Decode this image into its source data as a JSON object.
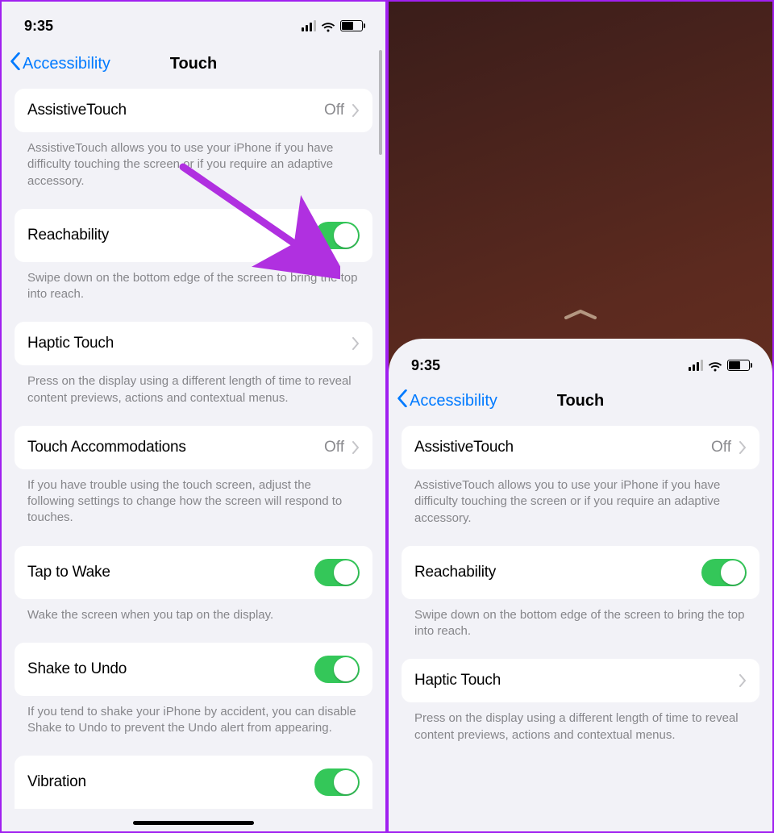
{
  "status": {
    "time": "9:35"
  },
  "nav": {
    "back": "Accessibility",
    "title": "Touch"
  },
  "rows": {
    "assistive": {
      "label": "AssistiveTouch",
      "value": "Off",
      "footer": "AssistiveTouch allows you to use your iPhone if you have difficulty touching the screen or if you require an adaptive accessory."
    },
    "reachability": {
      "label": "Reachability",
      "footer": "Swipe down on the bottom edge of the screen to bring the top into reach."
    },
    "haptic": {
      "label": "Haptic Touch",
      "footer": "Press on the display using a different length of time to reveal content previews, actions and contextual menus."
    },
    "accommodations": {
      "label": "Touch Accommodations",
      "value": "Off",
      "footer": "If you have trouble using the touch screen, adjust the following settings to change how the screen will respond to touches."
    },
    "tapwake": {
      "label": "Tap to Wake",
      "footer": "Wake the screen when you tap on the display."
    },
    "shake": {
      "label": "Shake to Undo",
      "footer": "If you tend to shake your iPhone by accident, you can disable Shake to Undo to prevent the Undo alert from appearing."
    },
    "vibration": {
      "label": "Vibration"
    }
  }
}
